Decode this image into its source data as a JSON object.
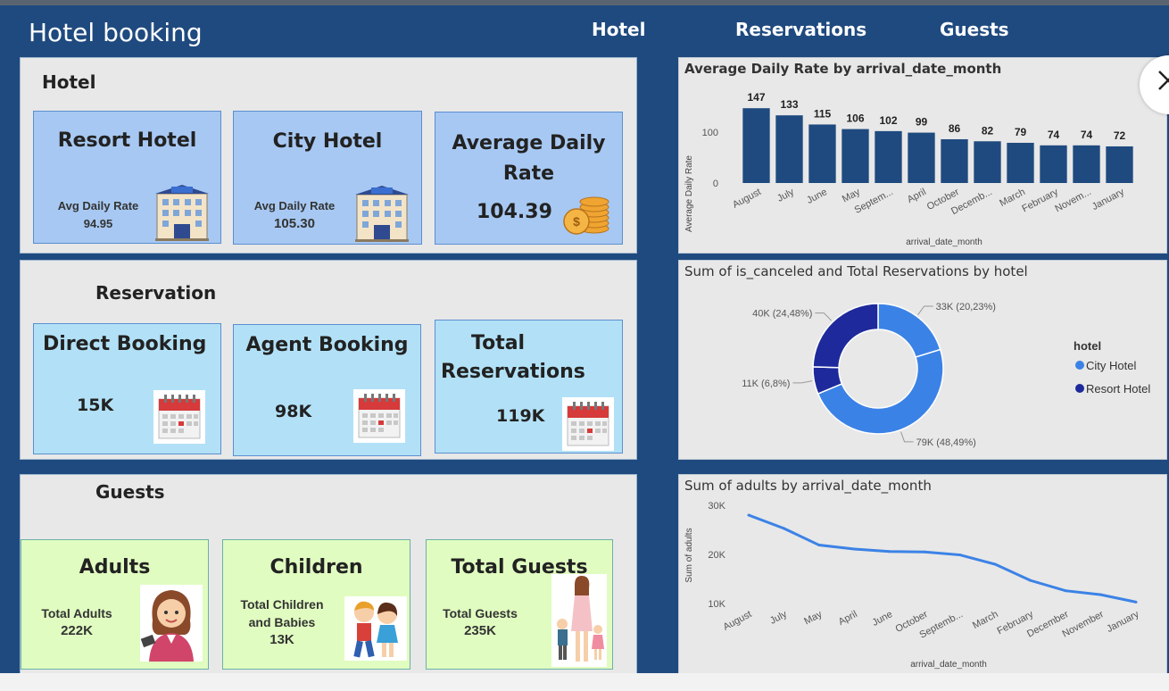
{
  "app": {
    "title": "Hotel booking"
  },
  "nav": [
    {
      "label": "Hotel"
    },
    {
      "label": "Reservations"
    },
    {
      "label": "Guests"
    }
  ],
  "hotel": {
    "title": "Hotel",
    "resort": {
      "title": "Resort Hotel",
      "label": "Avg Daily Rate",
      "value": "94.95"
    },
    "city": {
      "title": "City Hotel",
      "label": "Avg Daily Rate",
      "value": "105.30"
    },
    "adr": {
      "title_line1": "Average Daily",
      "title_line2": "Rate",
      "value": "104.39"
    }
  },
  "reservation": {
    "title": "Reservation",
    "direct": {
      "title": "Direct Booking",
      "value": "15K"
    },
    "agent": {
      "title": "Agent Booking",
      "value": "98K"
    },
    "total": {
      "title_line1": "Total",
      "title_line2": "Reservations",
      "value": "119K"
    }
  },
  "guests": {
    "title": "Guests",
    "adults": {
      "title": "Adults",
      "label": "Total Adults",
      "value": "222K"
    },
    "children": {
      "title": "Children",
      "label_line1": "Total Children",
      "label_line2": "and Babies",
      "value": "13K"
    },
    "total": {
      "title": "Total Guests",
      "label": "Total Guests",
      "value": "235K"
    }
  },
  "colors": {
    "background": "#1f4a7f",
    "bar": "#1f4a7f",
    "city": "#3b82e6",
    "resort": "#1e2a9b",
    "line": "#3b82e6"
  },
  "icons": [
    "hotel-building-icon",
    "coins-icon",
    "calendar-icon",
    "woman-avatar-icon",
    "children-icon",
    "family-icon",
    "close-icon"
  ],
  "chart_data": [
    {
      "type": "bar",
      "title": "Average Daily Rate by arrival_date_month",
      "xlabel": "arrival_date_month",
      "ylabel": "Average Daily Rate",
      "categories": [
        "August",
        "July",
        "June",
        "May",
        "Septem...",
        "April",
        "October",
        "Decemb...",
        "March",
        "February",
        "Novem...",
        "January"
      ],
      "values": [
        147,
        133,
        115,
        106,
        102,
        99,
        86,
        82,
        79,
        74,
        74,
        72
      ],
      "yticks": [
        "0",
        "100"
      ],
      "ylim": [
        0,
        160
      ],
      "grid": false
    },
    {
      "type": "pie",
      "title": "Sum of is_canceled and Total Reservations by hotel",
      "legend_title": "hotel",
      "legend_position": "right",
      "legend": [
        "City Hotel",
        "Resort Hotel"
      ],
      "slices": [
        {
          "hotel": "City Hotel",
          "value": 33,
          "label": "33K (20,23%)"
        },
        {
          "hotel": "City Hotel",
          "value": 79,
          "label": "79K (48,49%)"
        },
        {
          "hotel": "Resort Hotel",
          "value": 11,
          "label": "11K (6,8%)"
        },
        {
          "hotel": "Resort Hotel",
          "value": 40,
          "label": "40K (24,48%)"
        }
      ]
    },
    {
      "type": "line",
      "title": "Sum of adults by arrival_date_month",
      "xlabel": "arrival_date_month",
      "ylabel": "Sum of adults",
      "categories": [
        "August",
        "July",
        "May",
        "April",
        "June",
        "October",
        "Septemb...",
        "March",
        "February",
        "December",
        "November",
        "January"
      ],
      "values": [
        28000,
        25300,
        21900,
        21100,
        20600,
        20500,
        19900,
        18000,
        14700,
        12600,
        11800,
        10300
      ],
      "yticks": [
        "10K",
        "20K",
        "30K"
      ],
      "ylim": [
        10000,
        30000
      ],
      "grid": false
    }
  ]
}
